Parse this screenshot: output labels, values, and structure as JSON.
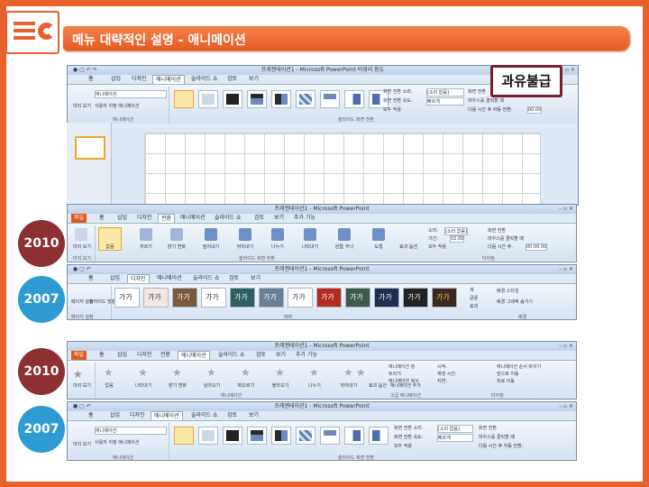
{
  "title": "메뉴 대략적인 설명 - 애니메이션",
  "stamp": "과유불급",
  "badges": [
    "2010",
    "2007",
    "2010",
    "2007"
  ],
  "top_window": {
    "title": "프레젠테이션1 - Microsoft PowerPoint 비영리 용도",
    "tabs": [
      "홈",
      "삽입",
      "디자인",
      "애니메이션",
      "슬라이드 쇼",
      "검토",
      "보기"
    ],
    "active_tab": "애니메이션",
    "preview_label": "미리 보기",
    "animation_dropdown": "애니메이션:",
    "custom_animation": "사용자 지정 애니메이션",
    "group_animation": "애니메이션",
    "group_transition": "슬라이드 화면 전환",
    "transition_sound_label": "화면 전환 소리:",
    "transition_sound_value": "[소리 없음]",
    "transition_speed_label": "화면 전환 속도:",
    "transition_speed_value": "빠르게",
    "apply_all": "모두 적용",
    "advance_label": "화면 전환",
    "on_click": "마우스를 클릭할 때",
    "after_time": "다음 시간 후 자동 전환:",
    "after_time_value": "00:00"
  },
  "win2010_transitions": {
    "title": "프레젠테이션1 - Microsoft PowerPoint",
    "tabs": [
      "파일",
      "홈",
      "삽입",
      "디자인",
      "전환",
      "애니메이션",
      "슬라이드 쇼",
      "검토",
      "보기",
      "추가 기능"
    ],
    "active_tab": "전환",
    "preview_label": "미리 보기",
    "effects": [
      "없음",
      "자르기",
      "밝기 변화",
      "밀어내기",
      "닦아내기",
      "나누기",
      "나타내기",
      "원型 무늬",
      "도형"
    ],
    "effect_options": "효과 옵션",
    "sound_label": "소리:",
    "sound_value": "[소리 없음]",
    "duration_label": "기간:",
    "duration_value": "02.00",
    "apply_all": "모두 적용",
    "advance_label": "화면 전환",
    "on_click": "마우스를 클릭할 때",
    "after_label": "다음 시간 후:",
    "after_value": "00:00.00",
    "group_preview": "미리 보기",
    "group_transition": "슬라이드 화면 전환",
    "group_timing": "타이밍"
  },
  "win2007_design": {
    "title": "프레젠테이션1 - Microsoft PowerPoint",
    "tabs": [
      "홈",
      "삽입",
      "디자인",
      "애니메이션",
      "슬라이드 쇼",
      "검토",
      "보기"
    ],
    "active_tab": "디자인",
    "page_setup": "페이지 설정",
    "orientation": "슬라이드 방향",
    "group_page": "페이지 설정",
    "theme_text": "가가",
    "group_theme": "테마",
    "colors": "색",
    "fonts": "글꼴",
    "effects": "효과",
    "bg_styles": "배경 스타일",
    "hide_bg": "배경 그래픽 숨기기",
    "group_bg": "배경"
  },
  "win2010_animation": {
    "title": "프레젠테이션1 - Microsoft PowerPoint",
    "tabs": [
      "파일",
      "홈",
      "삽입",
      "디자인",
      "전환",
      "애니메이션",
      "슬라이드 쇼",
      "검토",
      "보기",
      "추가 기능"
    ],
    "active_tab": "애니메이션",
    "preview_label": "미리 보기",
    "effects": [
      "없음",
      "나타내기",
      "밝기 변화",
      "날아오기",
      "떠오르기",
      "올라오기",
      "나누기",
      "닦아내기"
    ],
    "effect_options": "효과 옵션",
    "add_animation": "애니메이션 추가",
    "animation_pane": "애니메이션 창",
    "trigger": "트리거",
    "painter": "애니메이션 복사",
    "start": "시작:",
    "duration": "재생 시간:",
    "delay": "지연:",
    "reorder": "애니메이션 순서 바꾸기",
    "move_earlier": "앞으로 이동",
    "move_later": "뒤로 이동",
    "group_animation": "애니메이션",
    "group_advanced": "고급 애니메이션",
    "group_timing": "타이밍"
  },
  "win2007_animation": {
    "title": "프레젠테이션1 - Microsoft PowerPoint",
    "tabs": [
      "홈",
      "삽입",
      "디자인",
      "애니메이션",
      "슬라이드 쇼",
      "검토",
      "보기"
    ],
    "active_tab": "애니메이션",
    "preview_label": "미리 보기",
    "animation_dropdown": "애니메이션:",
    "custom_animation": "사용자 지정 애니메이션",
    "group_animation": "애니메이션",
    "group_transition": "슬라이드 화면 전환",
    "transition_sound_label": "화면 전환 소리:",
    "transition_sound_value": "[소리 없음]",
    "transition_speed_label": "화면 전환 속도:",
    "transition_speed_value": "빠르게",
    "apply_all": "모두 적용",
    "advance_label": "화면 전환",
    "on_click": "마우스를 클릭할 때",
    "after_time": "다음 시간 후 자동 전환:"
  }
}
